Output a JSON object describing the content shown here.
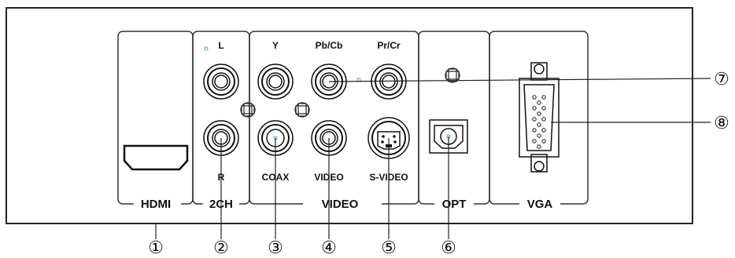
{
  "sections": {
    "hdmi": "HDMI",
    "ch2": "2CH",
    "video": "VIDEO",
    "opt": "OPT",
    "vga": "VGA"
  },
  "jack_labels": {
    "L": "L",
    "R": "R",
    "Y": "Y",
    "PbCb": "Pb/Cb",
    "PrCr": "Pr/Cr",
    "COAX": "COAX",
    "VIDEO": "VIDEO",
    "SVIDEO": "S-VIDEO"
  },
  "callouts": [
    "①",
    "②",
    "③",
    "④",
    "⑤",
    "⑥",
    "⑦",
    "⑧"
  ]
}
